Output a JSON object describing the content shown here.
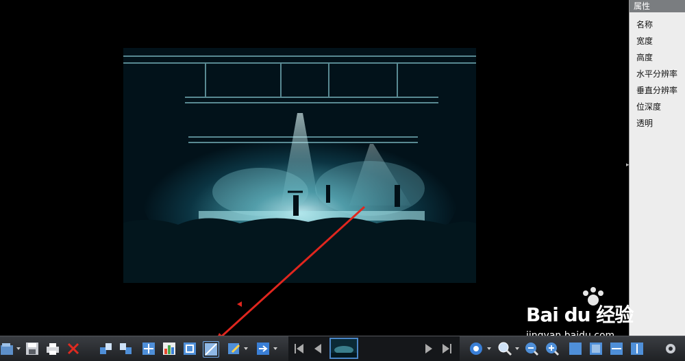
{
  "properties": {
    "header": "属性",
    "rows": [
      "名称",
      "宽度",
      "高度",
      "水平分辨率",
      "垂直分辨率",
      "位深度",
      "透明"
    ]
  },
  "watermark": {
    "logo": "Bai du 经验",
    "url": "jingyan.baidu.com"
  },
  "colors": {
    "accent": "#4a86c8",
    "annotation": "#e0261e",
    "panel": "#ededed"
  },
  "toolbar": {
    "icons": [
      "open-icon",
      "save-icon",
      "print-icon",
      "delete-icon",
      "rotate-left-icon",
      "rotate-right-icon",
      "move-icon",
      "histogram-icon",
      "fit-icon",
      "resize-icon",
      "edit-icon",
      "export-icon",
      "first-icon",
      "prev-icon",
      "next-icon",
      "last-icon",
      "settings-icon",
      "zoom-icon",
      "zoom-out-icon",
      "zoom-in-icon",
      "gear-icon"
    ]
  }
}
